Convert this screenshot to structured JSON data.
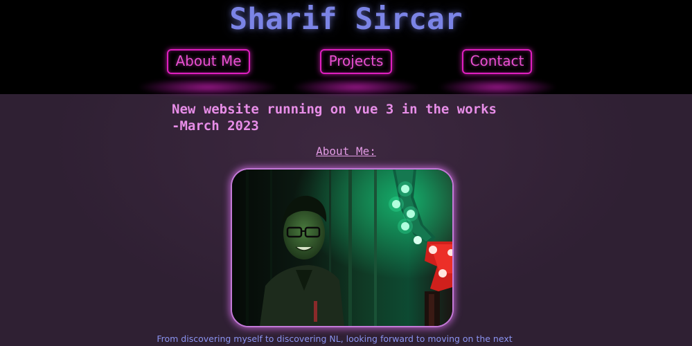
{
  "header": {
    "title": "Sharif Sircar",
    "nav": [
      {
        "label": "About Me"
      },
      {
        "label": "Projects"
      },
      {
        "label": "Contact"
      }
    ]
  },
  "main": {
    "news_line1": "New website running on vue 3 in the works",
    "news_line2": "-March 2023",
    "about_heading": "About Me:",
    "bio_text": "From discovering myself to discovering NL, looking forward to moving on the next"
  },
  "colors": {
    "header_bg": "#000000",
    "page_bg": "#2f2033",
    "title": "#7b84e6",
    "nav_neon": "#e01fc0",
    "news_text": "#e88ee8",
    "bio_text": "#8b93f0"
  }
}
